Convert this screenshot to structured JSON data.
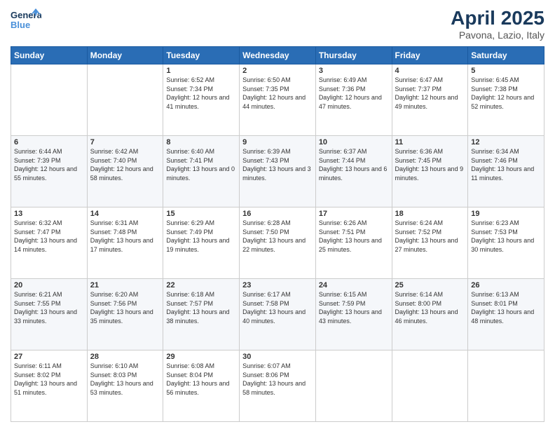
{
  "logo": {
    "line1": "General",
    "line2": "Blue"
  },
  "title": "April 2025",
  "location": "Pavona, Lazio, Italy",
  "days_of_week": [
    "Sunday",
    "Monday",
    "Tuesday",
    "Wednesday",
    "Thursday",
    "Friday",
    "Saturday"
  ],
  "weeks": [
    [
      {
        "day": "",
        "info": ""
      },
      {
        "day": "",
        "info": ""
      },
      {
        "day": "1",
        "info": "Sunrise: 6:52 AM\nSunset: 7:34 PM\nDaylight: 12 hours and 41 minutes."
      },
      {
        "day": "2",
        "info": "Sunrise: 6:50 AM\nSunset: 7:35 PM\nDaylight: 12 hours and 44 minutes."
      },
      {
        "day": "3",
        "info": "Sunrise: 6:49 AM\nSunset: 7:36 PM\nDaylight: 12 hours and 47 minutes."
      },
      {
        "day": "4",
        "info": "Sunrise: 6:47 AM\nSunset: 7:37 PM\nDaylight: 12 hours and 49 minutes."
      },
      {
        "day": "5",
        "info": "Sunrise: 6:45 AM\nSunset: 7:38 PM\nDaylight: 12 hours and 52 minutes."
      }
    ],
    [
      {
        "day": "6",
        "info": "Sunrise: 6:44 AM\nSunset: 7:39 PM\nDaylight: 12 hours and 55 minutes."
      },
      {
        "day": "7",
        "info": "Sunrise: 6:42 AM\nSunset: 7:40 PM\nDaylight: 12 hours and 58 minutes."
      },
      {
        "day": "8",
        "info": "Sunrise: 6:40 AM\nSunset: 7:41 PM\nDaylight: 13 hours and 0 minutes."
      },
      {
        "day": "9",
        "info": "Sunrise: 6:39 AM\nSunset: 7:43 PM\nDaylight: 13 hours and 3 minutes."
      },
      {
        "day": "10",
        "info": "Sunrise: 6:37 AM\nSunset: 7:44 PM\nDaylight: 13 hours and 6 minutes."
      },
      {
        "day": "11",
        "info": "Sunrise: 6:36 AM\nSunset: 7:45 PM\nDaylight: 13 hours and 9 minutes."
      },
      {
        "day": "12",
        "info": "Sunrise: 6:34 AM\nSunset: 7:46 PM\nDaylight: 13 hours and 11 minutes."
      }
    ],
    [
      {
        "day": "13",
        "info": "Sunrise: 6:32 AM\nSunset: 7:47 PM\nDaylight: 13 hours and 14 minutes."
      },
      {
        "day": "14",
        "info": "Sunrise: 6:31 AM\nSunset: 7:48 PM\nDaylight: 13 hours and 17 minutes."
      },
      {
        "day": "15",
        "info": "Sunrise: 6:29 AM\nSunset: 7:49 PM\nDaylight: 13 hours and 19 minutes."
      },
      {
        "day": "16",
        "info": "Sunrise: 6:28 AM\nSunset: 7:50 PM\nDaylight: 13 hours and 22 minutes."
      },
      {
        "day": "17",
        "info": "Sunrise: 6:26 AM\nSunset: 7:51 PM\nDaylight: 13 hours and 25 minutes."
      },
      {
        "day": "18",
        "info": "Sunrise: 6:24 AM\nSunset: 7:52 PM\nDaylight: 13 hours and 27 minutes."
      },
      {
        "day": "19",
        "info": "Sunrise: 6:23 AM\nSunset: 7:53 PM\nDaylight: 13 hours and 30 minutes."
      }
    ],
    [
      {
        "day": "20",
        "info": "Sunrise: 6:21 AM\nSunset: 7:55 PM\nDaylight: 13 hours and 33 minutes."
      },
      {
        "day": "21",
        "info": "Sunrise: 6:20 AM\nSunset: 7:56 PM\nDaylight: 13 hours and 35 minutes."
      },
      {
        "day": "22",
        "info": "Sunrise: 6:18 AM\nSunset: 7:57 PM\nDaylight: 13 hours and 38 minutes."
      },
      {
        "day": "23",
        "info": "Sunrise: 6:17 AM\nSunset: 7:58 PM\nDaylight: 13 hours and 40 minutes."
      },
      {
        "day": "24",
        "info": "Sunrise: 6:15 AM\nSunset: 7:59 PM\nDaylight: 13 hours and 43 minutes."
      },
      {
        "day": "25",
        "info": "Sunrise: 6:14 AM\nSunset: 8:00 PM\nDaylight: 13 hours and 46 minutes."
      },
      {
        "day": "26",
        "info": "Sunrise: 6:13 AM\nSunset: 8:01 PM\nDaylight: 13 hours and 48 minutes."
      }
    ],
    [
      {
        "day": "27",
        "info": "Sunrise: 6:11 AM\nSunset: 8:02 PM\nDaylight: 13 hours and 51 minutes."
      },
      {
        "day": "28",
        "info": "Sunrise: 6:10 AM\nSunset: 8:03 PM\nDaylight: 13 hours and 53 minutes."
      },
      {
        "day": "29",
        "info": "Sunrise: 6:08 AM\nSunset: 8:04 PM\nDaylight: 13 hours and 56 minutes."
      },
      {
        "day": "30",
        "info": "Sunrise: 6:07 AM\nSunset: 8:06 PM\nDaylight: 13 hours and 58 minutes."
      },
      {
        "day": "",
        "info": ""
      },
      {
        "day": "",
        "info": ""
      },
      {
        "day": "",
        "info": ""
      }
    ]
  ]
}
